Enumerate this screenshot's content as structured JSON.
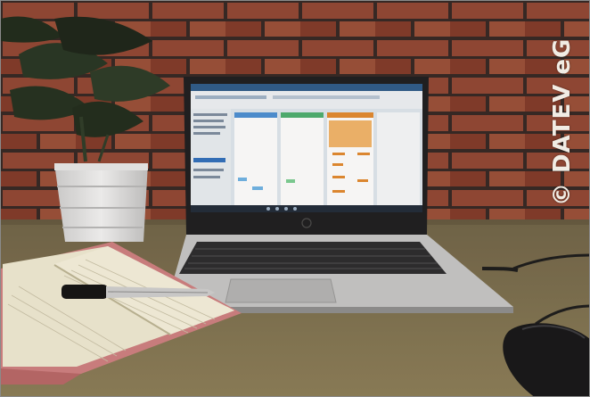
{
  "photo": {
    "copyright": "© DATEV eG"
  },
  "colors": {
    "brick": "#a24a34",
    "mortar": "#3a2a26",
    "desk": "#7a6d4a",
    "laptop_body": "#c9c9c9",
    "screen_bg": "#dfe7ee",
    "notebook_cover": "#d68a8a",
    "notebook_paper": "#efe9d2"
  },
  "icons": [
    "plant",
    "laptop",
    "notebook",
    "pen",
    "mouse"
  ]
}
